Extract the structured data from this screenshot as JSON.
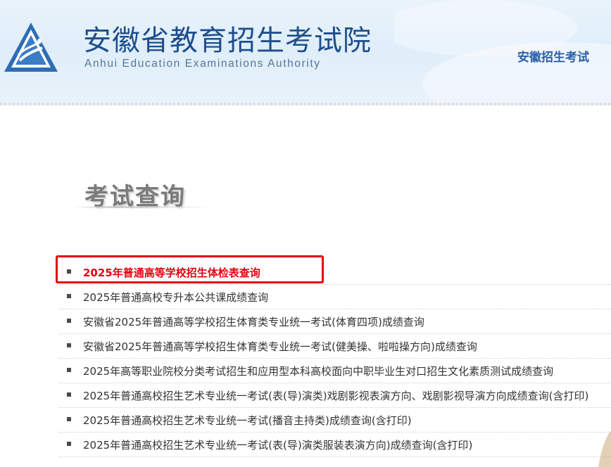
{
  "header": {
    "title": "安徽省教育招生考试院",
    "subtitle": "Anhui Education Examinations Authority",
    "link": "安徽招生考试"
  },
  "section": {
    "title": "考试查询"
  },
  "query_list": [
    {
      "label": "2025年普通高等学校招生体检表查询",
      "highlighted": true
    },
    {
      "label": "2025年普通高校专升本公共课成绩查询",
      "highlighted": false
    },
    {
      "label": "安徽省2025年普通高等学校招生体育类专业统一考试(体育四项)成绩查询",
      "highlighted": false
    },
    {
      "label": "安徽省2025年普通高等学校招生体育类专业统一考试(健美操、啦啦操方向)成绩查询",
      "highlighted": false
    },
    {
      "label": "2025年高等职业院校分类考试招生和应用型本科高校面向中职毕业生对口招生文化素质测试成绩查询",
      "highlighted": false
    },
    {
      "label": "2025年普通高校招生艺术专业统一考试(表(导)演类)戏剧影视表演方向、戏剧影视导演方向成绩查询(含打印)",
      "highlighted": false
    },
    {
      "label": "2025年普通高校招生艺术专业统一考试(播音主持类)成绩查询(含打印)",
      "highlighted": false
    },
    {
      "label": "2025年普通高校招生艺术专业统一考试(表(导)演类服装表演方向)成绩查询(含打印)",
      "highlighted": false
    }
  ],
  "colors": {
    "title_blue": "#1e4e8c",
    "highlight_red": "#e60012"
  }
}
